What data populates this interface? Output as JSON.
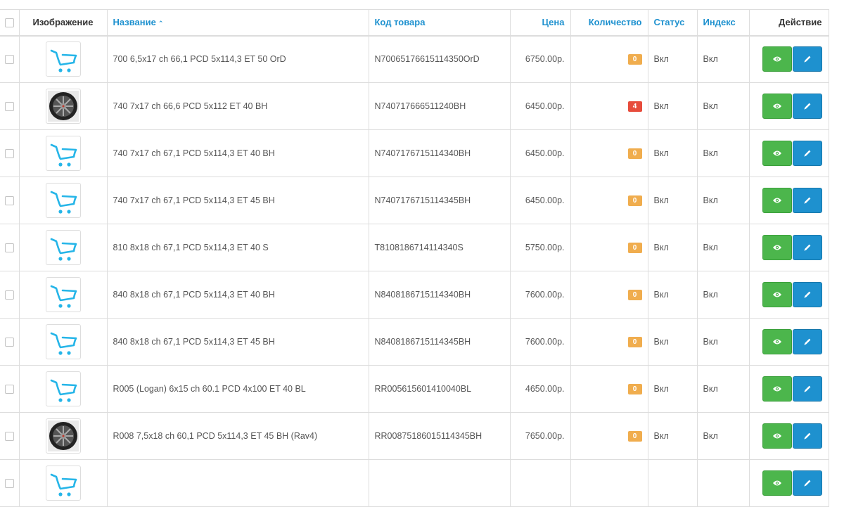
{
  "colors": {
    "link": "#1e91cf",
    "view_button": "#4cb64c",
    "edit_button": "#1e91cf",
    "badge_warning": "#f0ad4e",
    "badge_danger": "#e74c3c",
    "cart_icon": "#25b5e8"
  },
  "table": {
    "headers": {
      "image": "Изображение",
      "name": "Название",
      "sku": "Код товара",
      "price": "Цена",
      "quantity": "Количество",
      "status": "Статус",
      "index": "Индекс",
      "action": "Действие"
    },
    "sort_icon": "chevron-up-icon",
    "rows": [
      {
        "image": "cart-placeholder-icon",
        "name": "700 6,5x17 ch 66,1 PCD 5x114,3 ET 50 OrD",
        "sku": "N70065176615114350OrD",
        "price": "6750.00р.",
        "quantity": "0",
        "qty_level": "warning",
        "status": "Вкл",
        "index": "Вкл"
      },
      {
        "image": "wheel-photo",
        "name": "740 7x17 ch 66,6 PCD 5x112 ET 40 BH",
        "sku": "N740717666511240BH",
        "price": "6450.00р.",
        "quantity": "4",
        "qty_level": "danger",
        "status": "Вкл",
        "index": "Вкл"
      },
      {
        "image": "cart-placeholder-icon",
        "name": "740 7x17 ch 67,1 PCD 5x114,3 ET 40 BH",
        "sku": "N7407176715114340BH",
        "price": "6450.00р.",
        "quantity": "0",
        "qty_level": "warning",
        "status": "Вкл",
        "index": "Вкл"
      },
      {
        "image": "cart-placeholder-icon",
        "name": "740 7x17 ch 67,1 PCD 5x114,3 ET 45 BH",
        "sku": "N7407176715114345BH",
        "price": "6450.00р.",
        "quantity": "0",
        "qty_level": "warning",
        "status": "Вкл",
        "index": "Вкл"
      },
      {
        "image": "cart-placeholder-icon",
        "name": "810 8x18 ch 67,1 PCD 5x114,3 ET 40 S",
        "sku": "T8108186714114340S",
        "price": "5750.00р.",
        "quantity": "0",
        "qty_level": "warning",
        "status": "Вкл",
        "index": "Вкл"
      },
      {
        "image": "cart-placeholder-icon",
        "name": "840 8x18 ch 67,1 PCD 5x114,3 ET 40 BH",
        "sku": "N8408186715114340BH",
        "price": "7600.00р.",
        "quantity": "0",
        "qty_level": "warning",
        "status": "Вкл",
        "index": "Вкл"
      },
      {
        "image": "cart-placeholder-icon",
        "name": "840 8x18 ch 67,1 PCD 5x114,3 ET 45 BH",
        "sku": "N8408186715114345BH",
        "price": "7600.00р.",
        "quantity": "0",
        "qty_level": "warning",
        "status": "Вкл",
        "index": "Вкл"
      },
      {
        "image": "cart-placeholder-icon",
        "name": "R005 (Logan) 6x15 ch 60.1 PCD 4x100 ET 40 BL",
        "sku": "RR005615601410040BL",
        "price": "4650.00р.",
        "quantity": "0",
        "qty_level": "warning",
        "status": "Вкл",
        "index": "Вкл"
      },
      {
        "image": "wheel-photo",
        "name": "R008 7,5x18 ch 60,1 PCD 5x114,3 ET 45 BH (Rav4)",
        "sku": "RR00875186015114345BH",
        "price": "7650.00р.",
        "quantity": "0",
        "qty_level": "warning",
        "status": "Вкл",
        "index": "Вкл"
      },
      {
        "image": "cart-placeholder-icon",
        "name": "",
        "sku": "",
        "price": "",
        "quantity": "",
        "qty_level": "",
        "status": "",
        "index": ""
      }
    ]
  }
}
